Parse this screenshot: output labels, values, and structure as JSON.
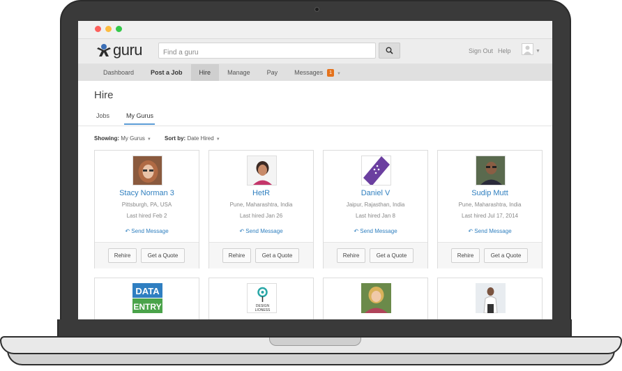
{
  "search": {
    "placeholder": "Find a guru"
  },
  "header": {
    "logo_text": "guru",
    "sign_out": "Sign Out",
    "help": "Help"
  },
  "nav": {
    "items": [
      {
        "label": "Dashboard"
      },
      {
        "label": "Post a Job"
      },
      {
        "label": "Hire"
      },
      {
        "label": "Manage"
      },
      {
        "label": "Pay"
      },
      {
        "label": "Messages"
      }
    ],
    "messages_badge": "1"
  },
  "page": {
    "title": "Hire"
  },
  "tabs": [
    {
      "label": "Jobs"
    },
    {
      "label": "My Gurus"
    }
  ],
  "filters": {
    "showing_label": "Showing:",
    "showing_value": "My Gurus",
    "sort_label": "Sort by:",
    "sort_value": "Date Hired"
  },
  "cards": [
    {
      "name": "Stacy Norman 3",
      "location": "Pittsburgh, PA, USA",
      "last_hired": "Last hired Feb 2",
      "message": "Send Message",
      "rehire": "Rehire",
      "quote": "Get a Quote"
    },
    {
      "name": "HetR",
      "location": "Pune, Maharashtra, India",
      "last_hired": "Last hired Jan 26",
      "message": "Send Message",
      "rehire": "Rehire",
      "quote": "Get a Quote"
    },
    {
      "name": "Daniel V",
      "location": "Jaipur, Rajasthan, India",
      "last_hired": "Last hired Jan 8",
      "message": "Send Message",
      "rehire": "Rehire",
      "quote": "Get a Quote"
    },
    {
      "name": "Sudip Mutt",
      "location": "Pune, Maharashtra, India",
      "last_hired": "Last hired Jul 17, 2014",
      "message": "Send Message",
      "rehire": "Rehire",
      "quote": "Get a Quote"
    }
  ],
  "second_row": {
    "data_entry_logo": {
      "line1": "DATA",
      "line2": "ENTRY"
    },
    "design_logo": {
      "line1": "DESIGN",
      "line2": "LIONESS"
    }
  },
  "colors": {
    "link": "#2f7fbf",
    "badge": "#e4721c",
    "tab_underline": "#5b9bd5"
  }
}
